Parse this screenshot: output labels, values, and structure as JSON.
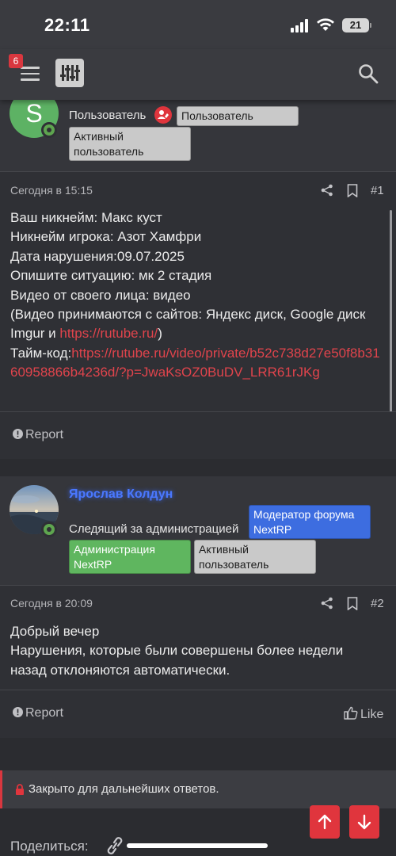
{
  "status_bar": {
    "time": "22:11",
    "battery": "21"
  },
  "header": {
    "notification_count": "6"
  },
  "post1": {
    "user_title": "Пользователь",
    "badges": [
      "Пользователь",
      "Активный пользователь"
    ],
    "badge_active_line1": "Активный",
    "badge_active_line2": "пользователь",
    "date": "Сегодня в 15:15",
    "number": "#1",
    "lines": [
      "Ваш никнейм: Макс куст",
      "Никнейм игрока: Азот Хамфри",
      "Дата нарушения:09.07.2025",
      "Опишите ситуацию: мк 2 стадия",
      "Видео от своего лица: видео"
    ],
    "note_prefix": "(Видео принимаются с сайтов: Яндекс диск, Google диск Imgur и ",
    "note_link": "https://rutube.ru/",
    "note_suffix": ")",
    "timecode_label": "Тайм-код:",
    "timecode_link": "https://rutube.ru/video/private/b52c738d27e50f8b3160958866b4236d/?p=JwaKsOZ0BuDV_LRR61rJKg",
    "report_label": "Report"
  },
  "post2": {
    "username": "Ярослав Колдун",
    "user_title": "Следящий за администрацией",
    "badge_moderator_line1": "Модератор форума",
    "badge_moderator_line2": "NextRP",
    "badge_admin_line1": "Администрация",
    "badge_admin_line2": "NextRP",
    "badge_active_line1": "Активный",
    "badge_active_line2": "пользователь",
    "date": "Сегодня в 20:09",
    "number": "#2",
    "lines": [
      "Добрый вечер",
      "Нарушения, которые были совершены более недели назад отклоняются автоматически."
    ],
    "report_label": "Report",
    "like_label": "Like"
  },
  "closed_notice": "Закрыто для дальнейших ответов.",
  "share_label": "Поделиться:",
  "colors": {
    "accent_red": "#e0353d",
    "online": "#5ea54f",
    "username": "#4a78ff"
  }
}
